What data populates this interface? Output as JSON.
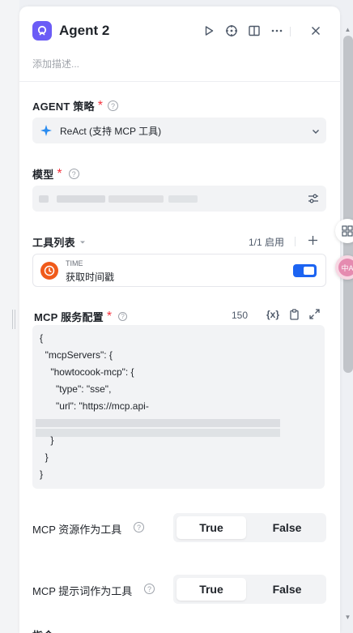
{
  "header": {
    "title": "Agent 2",
    "description_placeholder": "添加描述..."
  },
  "strategy": {
    "label": "AGENT 策略",
    "required": "*",
    "selected": "ReAct (支持 MCP 工具)"
  },
  "model": {
    "label": "模型",
    "required": "*"
  },
  "tools": {
    "label": "工具列表",
    "count": "1/1 启用",
    "items": [
      {
        "name": "TIME",
        "description": "获取时间戳",
        "enabled": true
      }
    ]
  },
  "mcp_config": {
    "label": "MCP 服务配置",
    "required": "*",
    "char_count": "150",
    "var_icon": "{x}",
    "code_lines": [
      "{",
      "  \"mcpServers\": {",
      "    \"howtocook-mcp\": {",
      "      \"type\": \"sse\",",
      "      \"url\": \"https://mcp.api-",
      "",
      "    }",
      "  }",
      "}"
    ]
  },
  "mcp_resources": {
    "label": "MCP 资源作为工具",
    "options": [
      "True",
      "False"
    ],
    "selected": "True"
  },
  "mcp_prompts": {
    "label": "MCP 提示词作为工具",
    "options": [
      "True",
      "False"
    ],
    "selected": "True"
  },
  "next_section": {
    "label": "指令"
  },
  "colors": {
    "accent": "#1c64f2",
    "required": "#f5313c",
    "agent_logo": "#6b5cf6",
    "time_icon": "#f05a1a"
  }
}
